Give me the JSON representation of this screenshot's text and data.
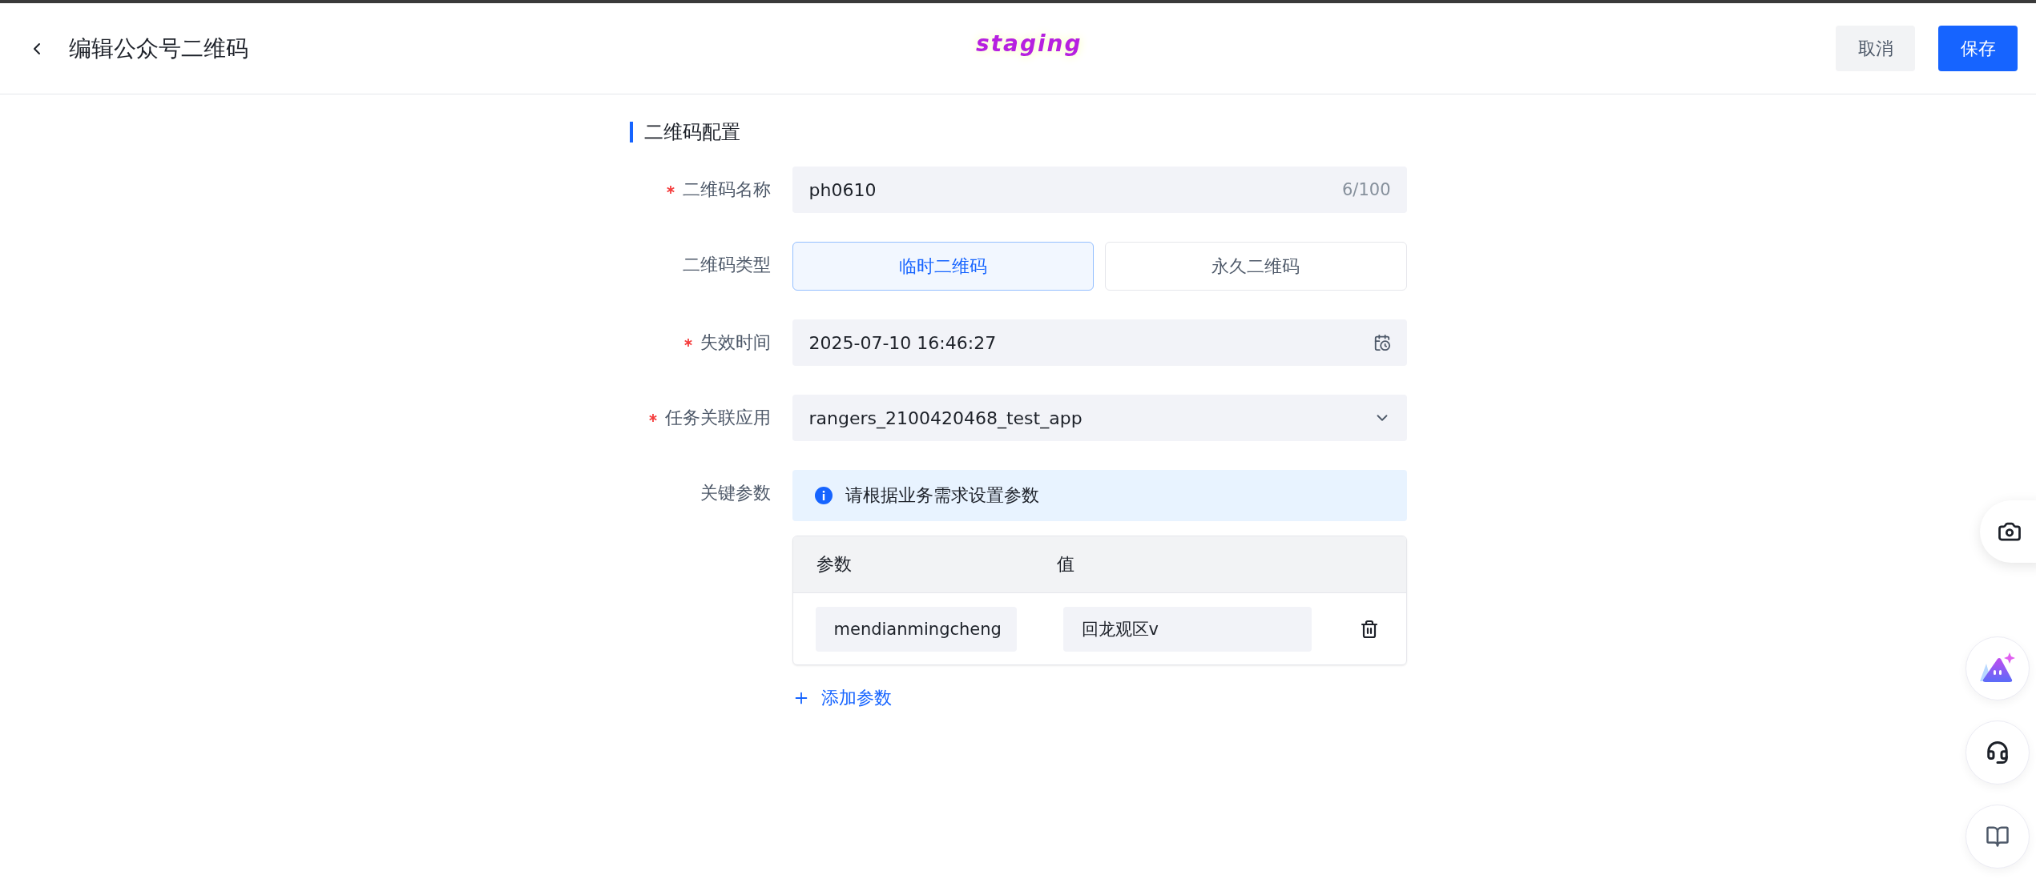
{
  "header": {
    "title": "编辑公众号二维码",
    "env_badge": "staging",
    "buttons": [
      {
        "label": "取消",
        "kind": "secondary"
      },
      {
        "label": "保存",
        "kind": "primary"
      }
    ]
  },
  "section": {
    "title": "二维码配置"
  },
  "fields": [
    {
      "kind": "text",
      "label": "二维码名称",
      "required": true,
      "value": "ph0610",
      "counter": "6/100"
    },
    {
      "kind": "segmented",
      "label": "二维码类型",
      "required": false,
      "options": [
        {
          "label": "临时二维码",
          "selected": true
        },
        {
          "label": "永久二维码",
          "selected": false
        }
      ]
    },
    {
      "kind": "date",
      "label": "失效时间",
      "required": true,
      "value": "2025-07-10 16:46:27"
    },
    {
      "kind": "select",
      "label": "任务关联应用",
      "required": true,
      "value": "rangers_2100420468_test_app"
    },
    {
      "kind": "params",
      "label": "关键参数",
      "required": false,
      "notice": "请根据业务需求设置参数",
      "columns": [
        "参数",
        "值"
      ],
      "rows": [
        {
          "key": "mendianmingcheng",
          "value": "回龙观区v"
        }
      ],
      "add_label": "添加参数"
    }
  ]
}
